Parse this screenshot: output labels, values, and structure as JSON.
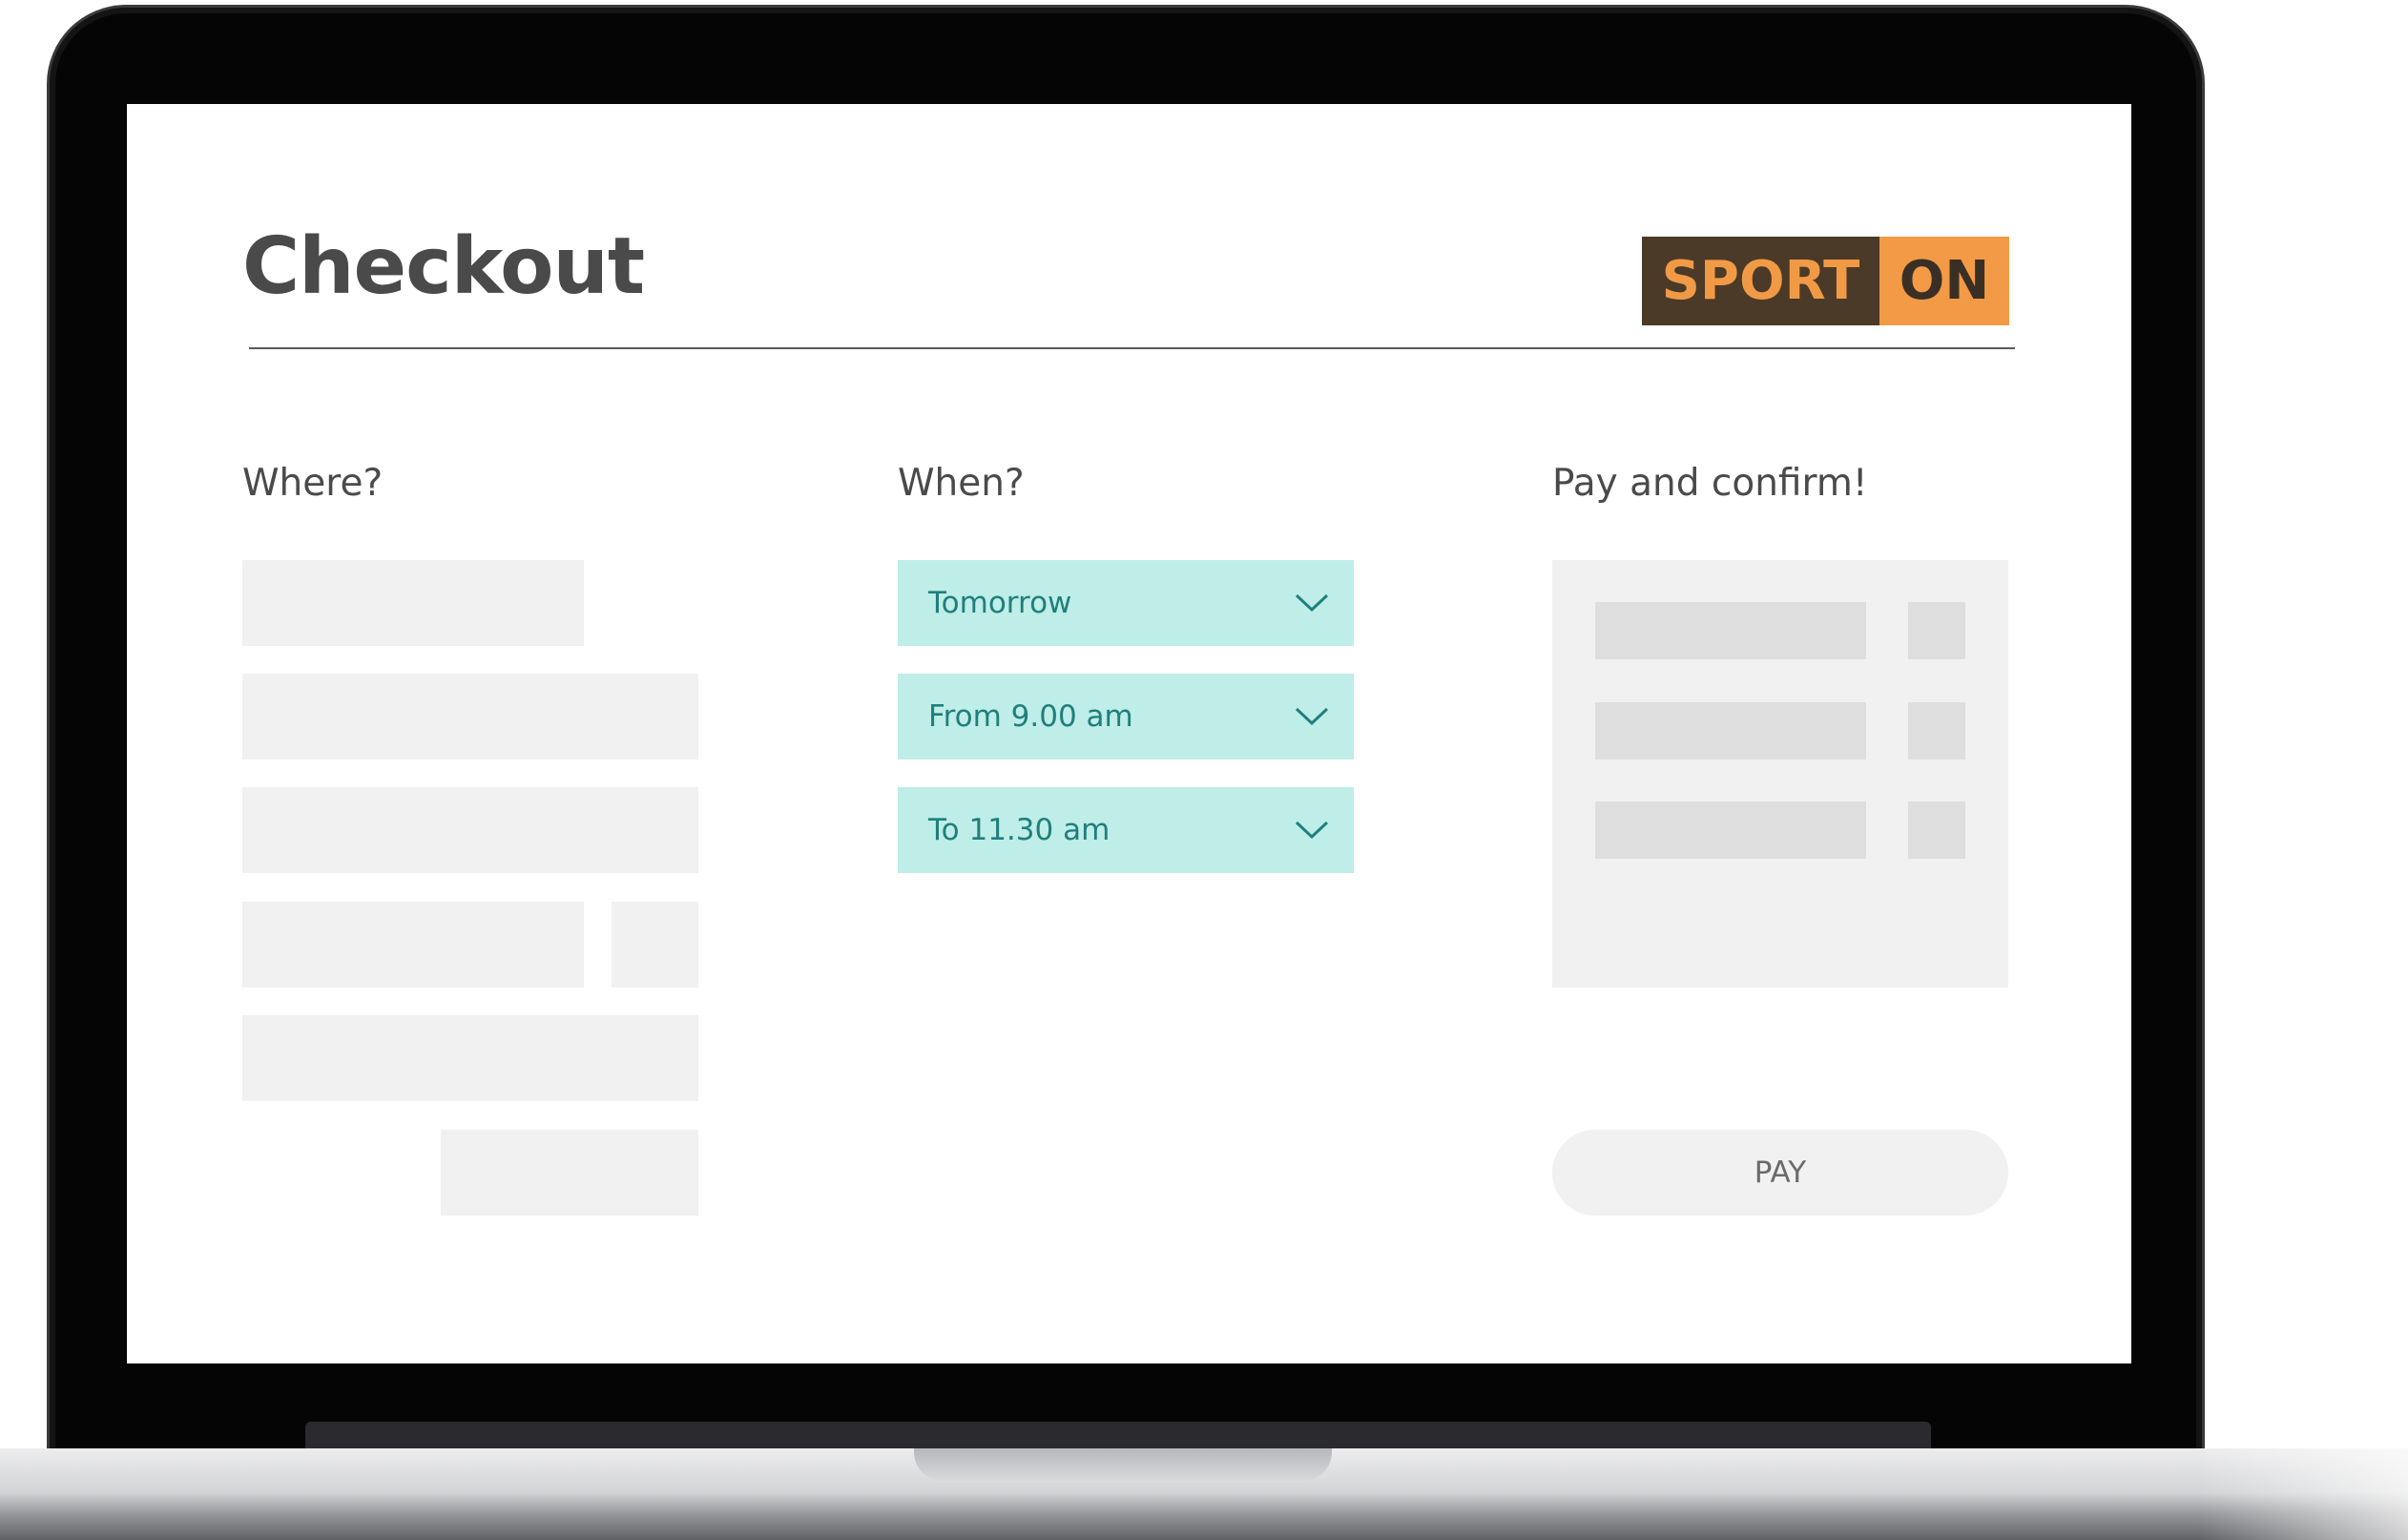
{
  "checkout": {
    "title": "Checkout",
    "brand": {
      "part1": "SPORT",
      "part2": "ON"
    },
    "columns": {
      "where": {
        "heading": "Where?"
      },
      "when": {
        "heading": "When?",
        "selects": [
          {
            "value": "Tomorrow",
            "icon": "chevron-down-icon"
          },
          {
            "value": "From 9.00 am",
            "icon": "chevron-down-icon"
          },
          {
            "value": "To 11.30 am",
            "icon": "chevron-down-icon"
          }
        ]
      },
      "pay": {
        "heading": "Pay and confirm!",
        "button_label": "PAY"
      }
    }
  },
  "colors": {
    "title_text": "#4a4a4a",
    "logo_dark": "#4b3a28",
    "logo_orange": "#f29a45",
    "select_bg": "#bfede7",
    "select_text": "#1f7f7d",
    "placeholder": "#f1f1f1",
    "laptop_bezel": "#050505"
  }
}
